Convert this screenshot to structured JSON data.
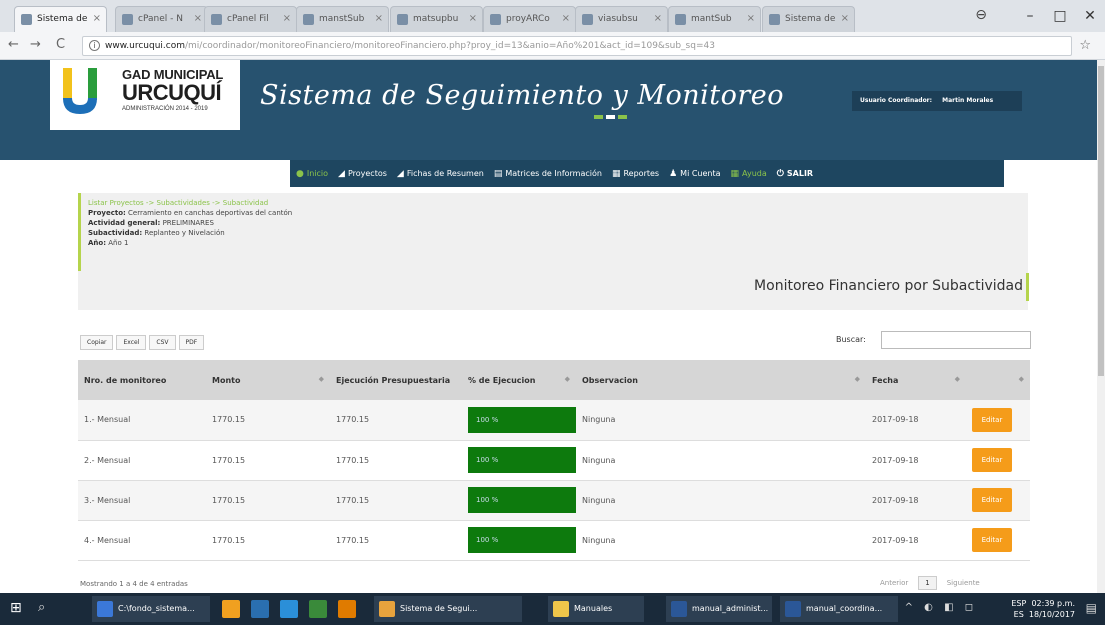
{
  "browser": {
    "tabs": [
      {
        "label": "Sistema de",
        "active": true
      },
      {
        "label": "cPanel - N"
      },
      {
        "label": "cPanel Fil"
      },
      {
        "label": "manstSub"
      },
      {
        "label": "matsupbu"
      },
      {
        "label": "proyARCo"
      },
      {
        "label": "viasubsu"
      },
      {
        "label": "mantSub"
      },
      {
        "label": "Sistema de"
      }
    ],
    "url_host": "www.urcuqui.com",
    "url_path": "/mi/coordinador/monitoreoFinanciero/monitoreoFinanciero.php?proy_id=13&anio=Año%201&act_id=109&sub_sq=43",
    "window_controls": [
      "–",
      "□",
      "✕"
    ],
    "icons": {
      "back": "back-arrow-icon",
      "forward": "forward-arrow-icon",
      "reload": "reload-icon",
      "star": "star-icon",
      "profile": "profile-icon"
    }
  },
  "site": {
    "logo": {
      "line1": "GAD MUNICIPAL",
      "line2": "URCUQUÍ",
      "line3": "ADMINISTRACIÓN 2014 - 2019"
    },
    "title": "Sistema de Seguimiento y Monitoreo",
    "user_label": "Usuario Coordinador:",
    "user_name": "Martin Morales",
    "accent_colors": [
      "#8bc34a",
      "#ffffff",
      "#8bc34a"
    ]
  },
  "nav": [
    {
      "icon": "home-icon",
      "glyph": "●",
      "label": "Inicio"
    },
    {
      "icon": "folder-icon",
      "glyph": "◢",
      "label": "Proyectos"
    },
    {
      "icon": "folder-icon",
      "glyph": "◢",
      "label": "Fichas de Resumen"
    },
    {
      "icon": "grid-icon",
      "glyph": "▤",
      "label": "Matrices de Información"
    },
    {
      "icon": "report-icon",
      "glyph": "▦",
      "label": "Reportes"
    },
    {
      "icon": "user-icon",
      "glyph": "♟",
      "label": "Mi Cuenta"
    },
    {
      "icon": "help-icon",
      "glyph": "▦",
      "label": "Ayuda"
    },
    {
      "icon": "power-icon",
      "glyph": "⏻",
      "label": "SALIR"
    }
  ],
  "info": {
    "breadcrumb": "Listar Proyectos -> Subactividades -> Subactividad",
    "project_label": "Proyecto:",
    "project_value": "Cerramiento en canchas deportivas del cantón",
    "activity_label": "Actividad general:",
    "activity_value": "PRELIMINARES",
    "subactivity_label": "Subactividad:",
    "subactivity_value": "Replanteo y Nivelación",
    "year_label": "Año:",
    "year_value": "Año 1"
  },
  "section_title": "Monitoreo Financiero por Subactividad",
  "toolbar": {
    "buttons": [
      "Copiar",
      "Excel",
      "CSV",
      "PDF"
    ],
    "search_label": "Buscar:",
    "search_value": ""
  },
  "table": {
    "headers": [
      "Nro. de monitoreo",
      "Monto",
      "Ejecución Presupuestaria",
      "% de Ejecucion",
      "Observacion",
      "Fecha",
      ""
    ],
    "rows": [
      {
        "nro": "1.- Mensual",
        "monto": "1770.15",
        "ejecucion": "1770.15",
        "porcentaje": "100 %",
        "porcentaje_value": 100,
        "observacion": "Ninguna",
        "fecha": "2017-09-18",
        "accion": "Editar"
      },
      {
        "nro": "2.- Mensual",
        "monto": "1770.15",
        "ejecucion": "1770.15",
        "porcentaje": "100 %",
        "porcentaje_value": 100,
        "observacion": "Ninguna",
        "fecha": "2017-09-18",
        "accion": "Editar"
      },
      {
        "nro": "3.- Mensual",
        "monto": "1770.15",
        "ejecucion": "1770.15",
        "porcentaje": "100 %",
        "porcentaje_value": 100,
        "observacion": "Ninguna",
        "fecha": "2017-09-18",
        "accion": "Editar"
      },
      {
        "nro": "4.- Mensual",
        "monto": "1770.15",
        "ejecucion": "1770.15",
        "porcentaje": "100 %",
        "porcentaje_value": 100,
        "observacion": "Ninguna",
        "fecha": "2017-09-18",
        "accion": "Editar"
      }
    ],
    "info": "Mostrando 1 a 4 de 4 entradas",
    "pager": {
      "prev": "Anterior",
      "current": "1",
      "next": "Siguiente"
    }
  },
  "taskbar": {
    "apps": [
      {
        "label": "C:\\fondo_sistema...",
        "color": "#3b78d8"
      },
      {
        "label": "Sistema de Segui...",
        "color": "#e8a33d"
      },
      {
        "label": "Manuales",
        "color": "#f0c64a"
      },
      {
        "label": "manual_administ...",
        "color": "#2b5797"
      },
      {
        "label": "manual_coordina...",
        "color": "#2b5797"
      }
    ],
    "pinned_colors": [
      "#f0a020",
      "#2a6fb0",
      "#2b8fd8",
      "#3a8a3a",
      "#e07b00"
    ],
    "time": "02:39 p.m.",
    "date": "18/10/2017",
    "lang": "ESP",
    "lang_sub": "ES"
  }
}
